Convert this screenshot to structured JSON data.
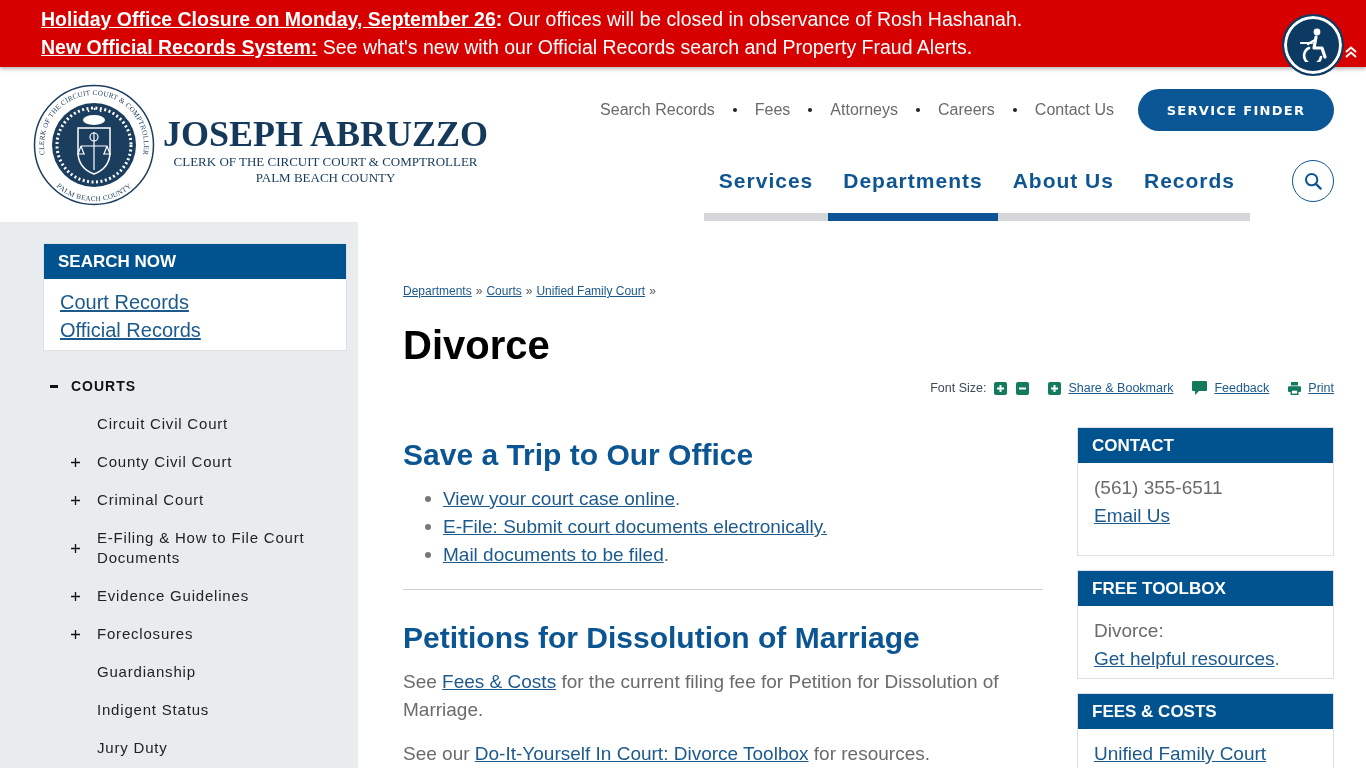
{
  "alert_banner": {
    "items": [
      {
        "link": "Holiday Office Closure on Monday, September 26",
        "link_suffix": ":",
        "text": "Our offices will be closed in observance of Rosh Hashanah."
      },
      {
        "link": "New Official Records System:",
        "text": "See what's new with our Official Records search and Property Fraud Alerts."
      }
    ]
  },
  "header": {
    "logo": {
      "seal_top_text": "CLERK OF THE CIRCUIT COURT & COMPTROLLER",
      "seal_bottom_text": "PALM BEACH COUNTY",
      "name": "JOSEPH ABRUZZO",
      "title": "CLERK OF THE CIRCUIT COURT & COMPTROLLER",
      "county": "PALM BEACH COUNTY"
    },
    "utility_nav": [
      "Search Records",
      "Fees",
      "Attorneys",
      "Careers",
      "Contact Us"
    ],
    "service_finder": "SERVICE FINDER",
    "main_nav": [
      {
        "label": "Services",
        "selected": false
      },
      {
        "label": "Departments",
        "selected": true
      },
      {
        "label": "About Us",
        "selected": false
      },
      {
        "label": "Records",
        "selected": false
      }
    ]
  },
  "sidebar": {
    "search_now": {
      "title": "SEARCH NOW",
      "links": [
        "Court Records",
        "Official Records"
      ]
    },
    "section_nav": {
      "label": "COURTS",
      "expanded": true,
      "children": [
        {
          "label": "Circuit Civil Court",
          "expandable": false
        },
        {
          "label": "County Civil Court",
          "expandable": true
        },
        {
          "label": "Criminal Court",
          "expandable": true
        },
        {
          "label": "E-Filing & How to File Court Documents",
          "expandable": true
        },
        {
          "label": "Evidence Guidelines",
          "expandable": true
        },
        {
          "label": "Foreclosures",
          "expandable": true
        },
        {
          "label": "Guardianship",
          "expandable": false
        },
        {
          "label": "Indigent Status",
          "expandable": false
        },
        {
          "label": "Jury Duty",
          "expandable": false
        }
      ]
    }
  },
  "page": {
    "breadcrumb": [
      {
        "label": "Departments",
        "separator": "»"
      },
      {
        "label": "Courts",
        "separator": "»"
      },
      {
        "label": "Unified Family Court",
        "separator": "»"
      }
    ],
    "title": "Divorce",
    "tools": {
      "font_size_label": "Font Size:",
      "links": [
        {
          "kind": "share",
          "label": "Share & Bookmark"
        },
        {
          "kind": "feedback",
          "label": "Feedback"
        },
        {
          "kind": "print",
          "label": "Print"
        }
      ]
    },
    "sections": [
      {
        "heading": "Save a Trip to Our Office",
        "list": [
          {
            "link": "View your court case online",
            "after": "."
          },
          {
            "link": "E-File: Submit court documents electronically."
          },
          {
            "link": "Mail documents to be filed",
            "after": "."
          }
        ]
      },
      {
        "heading": "Petitions for Dissolution of Marriage",
        "paragraphs": [
          [
            {
              "kind": "text",
              "text": "See "
            },
            {
              "kind": "link",
              "text": "Fees & Costs"
            },
            {
              "kind": "text",
              "text": " for the current filing fee for Petition for Dissolution of Marriage."
            }
          ],
          [
            {
              "kind": "text",
              "text": "See our "
            },
            {
              "kind": "link",
              "text": "Do-It-Yourself In Court: Divorce Toolbox"
            },
            {
              "kind": "text",
              "text": " for resources."
            }
          ]
        ]
      }
    ],
    "side_cards": [
      {
        "title": "CONTACT",
        "paragraphs": [
          [
            {
              "kind": "phone",
              "text": "(561) 355-6511"
            }
          ],
          [
            {
              "kind": "link",
              "text": "Email Us"
            }
          ]
        ]
      },
      {
        "title": "FREE TOOLBOX",
        "paragraphs": [
          [
            {
              "kind": "text",
              "text": "Divorce: "
            },
            {
              "kind": "link",
              "text": "Get helpful resources"
            },
            {
              "kind": "text",
              "text": "."
            }
          ]
        ]
      },
      {
        "title": "FEES & COSTS",
        "paragraphs": [
          [
            {
              "kind": "link",
              "text": "Unified Family Court"
            }
          ]
        ]
      }
    ]
  }
}
